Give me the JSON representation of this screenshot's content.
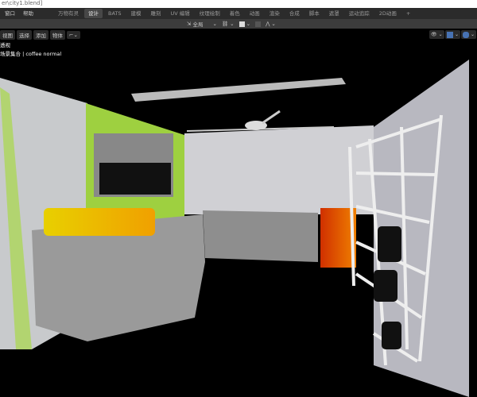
{
  "window": {
    "title": "er\\city1.blend]"
  },
  "menu": [
    "窗口",
    "帮助"
  ],
  "tabs": [
    {
      "label": "万物有灵"
    },
    {
      "label": "设计",
      "active": true
    },
    {
      "label": "BATS"
    },
    {
      "label": "建模"
    },
    {
      "label": "雕刻"
    },
    {
      "label": "UV 编辑"
    },
    {
      "label": "纹理绘制"
    },
    {
      "label": "着色"
    },
    {
      "label": "动画"
    },
    {
      "label": "渲染"
    },
    {
      "label": "合成"
    },
    {
      "label": "脚本"
    },
    {
      "label": "遮罩"
    },
    {
      "label": "运动追踪"
    },
    {
      "label": "2D动画"
    },
    {
      "label": "+"
    }
  ],
  "toolbar": {
    "orientation": "全局"
  },
  "viewport_menu": [
    "视图",
    "选择",
    "添加",
    "物体"
  ],
  "overlay": {
    "view": "透视",
    "collection": "场景集合 | coffee normal"
  },
  "colors": {
    "accent": "#4772b3",
    "active_tab": "#474747"
  }
}
